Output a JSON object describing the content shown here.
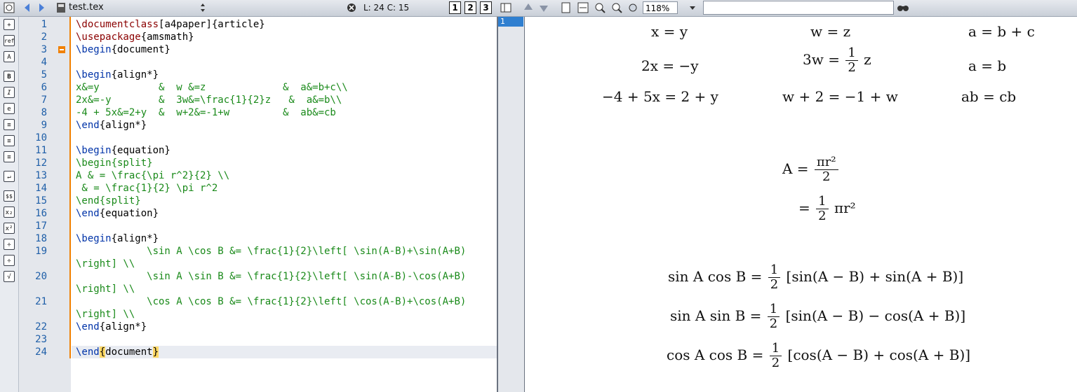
{
  "toolbar": {
    "file_name": "test.tex",
    "status": "L: 24 C: 15",
    "layout_buttons": [
      "1",
      "2",
      "3"
    ],
    "zoom": "118%",
    "search_value": ""
  },
  "sidebar": {
    "buttons": [
      "+",
      "ref",
      "A",
      "B",
      "I",
      "e",
      "≡",
      "≡",
      "≡",
      "↵",
      "$$",
      "x₂",
      "x²",
      "÷",
      "÷",
      "√"
    ]
  },
  "editor": {
    "line_numbers": [
      "1",
      "2",
      "3",
      "4",
      "5",
      "6",
      "7",
      "8",
      "9",
      "10",
      "11",
      "12",
      "13",
      "14",
      "15",
      "16",
      "17",
      "18",
      "19",
      "",
      "20",
      "",
      "21",
      "",
      "22",
      "23",
      "24"
    ],
    "lines": [
      {
        "parts": [
          {
            "t": "\\documentclass",
            "c": "red"
          },
          {
            "t": "[a4paper]{article}",
            "c": "black"
          }
        ]
      },
      {
        "parts": [
          {
            "t": "\\usepackage",
            "c": "red"
          },
          {
            "t": "{amsmath}",
            "c": "black"
          }
        ]
      },
      {
        "parts": [
          {
            "t": "\\begin",
            "c": "blue"
          },
          {
            "t": "{document}",
            "c": "black"
          }
        ]
      },
      {
        "parts": []
      },
      {
        "parts": [
          {
            "t": "\\begin",
            "c": "blue"
          },
          {
            "t": "{align*}",
            "c": "black"
          }
        ]
      },
      {
        "parts": [
          {
            "t": "x&=y          &  w &=z             &  a&=b+c\\\\",
            "c": "green"
          }
        ]
      },
      {
        "parts": [
          {
            "t": "2x&=-y        &  3w&=\\frac{1}{2}z   &  a&=b\\\\",
            "c": "green"
          }
        ]
      },
      {
        "parts": [
          {
            "t": "-4 + 5x&=2+y  &  w+2&=-1+w         &  ab&=cb",
            "c": "green"
          }
        ]
      },
      {
        "parts": [
          {
            "t": "\\end",
            "c": "blue"
          },
          {
            "t": "{align*}",
            "c": "black"
          }
        ]
      },
      {
        "parts": []
      },
      {
        "parts": [
          {
            "t": "\\begin",
            "c": "blue"
          },
          {
            "t": "{equation}",
            "c": "black"
          }
        ]
      },
      {
        "parts": [
          {
            "t": "\\begin{split}",
            "c": "green"
          }
        ]
      },
      {
        "parts": [
          {
            "t": "A & = \\frac{\\pi r^2}{2} \\\\",
            "c": "green"
          }
        ]
      },
      {
        "parts": [
          {
            "t": " & = \\frac{1}{2} \\pi r^2",
            "c": "green"
          }
        ]
      },
      {
        "parts": [
          {
            "t": "\\end{split}",
            "c": "green"
          }
        ]
      },
      {
        "parts": [
          {
            "t": "\\end",
            "c": "blue"
          },
          {
            "t": "{equation}",
            "c": "black"
          }
        ]
      },
      {
        "parts": []
      },
      {
        "parts": [
          {
            "t": "\\begin",
            "c": "blue"
          },
          {
            "t": "{align*}",
            "c": "black"
          }
        ]
      },
      {
        "parts": [
          {
            "t": "            \\sin A \\cos B &= \\frac{1}{2}\\left[ \\sin(A-B)+\\sin(A+B)",
            "c": "green"
          }
        ]
      },
      {
        "parts": [
          {
            "t": "\\right] \\\\",
            "c": "green"
          }
        ]
      },
      {
        "parts": [
          {
            "t": "            \\sin A \\sin B &= \\frac{1}{2}\\left[ \\sin(A-B)-\\cos(A+B)",
            "c": "green"
          }
        ]
      },
      {
        "parts": [
          {
            "t": "\\right] \\\\",
            "c": "green"
          }
        ]
      },
      {
        "parts": [
          {
            "t": "            \\cos A \\cos B &= \\frac{1}{2}\\left[ \\cos(A-B)+\\cos(A+B)",
            "c": "green"
          }
        ]
      },
      {
        "parts": [
          {
            "t": "\\right] \\\\",
            "c": "green"
          }
        ]
      },
      {
        "parts": [
          {
            "t": "\\end",
            "c": "blue"
          },
          {
            "t": "{align*}",
            "c": "black"
          }
        ]
      },
      {
        "parts": []
      },
      {
        "parts": [
          {
            "t": "\\end",
            "c": "blue"
          },
          {
            "t": "{",
            "c": "black"
          },
          {
            "t": "document",
            "c": "black"
          },
          {
            "t": "}",
            "c": "black"
          }
        ]
      }
    ]
  },
  "preview": {
    "page_number": "1",
    "row1": [
      "x = y",
      "w = z",
      "a = b + c"
    ],
    "row2_left": "2x = −y",
    "row2_mid_pre": "3w =",
    "row2_mid_num": "1",
    "row2_mid_den": "2",
    "row2_mid_post": "z",
    "row2_right": "a = b",
    "row3": [
      "−4 + 5x = 2 + y",
      "w + 2 = −1 + w",
      "ab = cb"
    ],
    "eq_A_pre": "A =",
    "eq_A_num": "πr²",
    "eq_A_den": "2",
    "eq_B_pre": "=",
    "eq_B_num": "1",
    "eq_B_den": "2",
    "eq_B_post": "πr²",
    "trig": [
      {
        "lhs": "sin A cos B =",
        "num": "1",
        "den": "2",
        "rhs": "[sin(A − B) + sin(A + B)]"
      },
      {
        "lhs": "sin A sin B =",
        "num": "1",
        "den": "2",
        "rhs": "[sin(A − B) − cos(A + B)]"
      },
      {
        "lhs": "cos A cos B =",
        "num": "1",
        "den": "2",
        "rhs": "[cos(A − B) + cos(A + B)]"
      }
    ]
  }
}
